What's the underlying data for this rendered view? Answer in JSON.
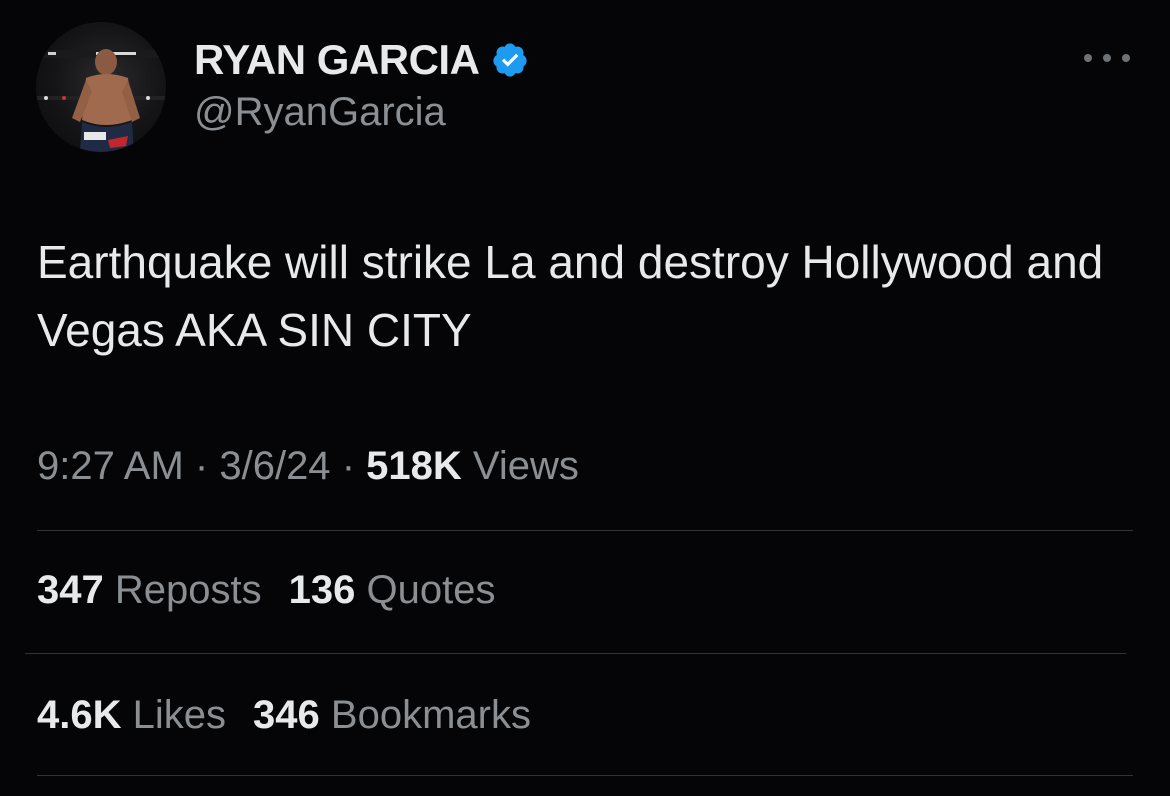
{
  "author": {
    "display_name": "RYAN GARCIA",
    "handle": "@RyanGarcia",
    "verified": true,
    "verified_color": "#1d9bf0"
  },
  "tweet": {
    "text": "Earthquake will strike La and destroy Hollywood and Vegas AKA SIN CITY",
    "time": "9:27 AM",
    "date": "3/6/24",
    "separator": "·",
    "views_count": "518K",
    "views_label": "Views"
  },
  "engagement": {
    "reposts_count": "347",
    "reposts_label": "Reposts",
    "quotes_count": "136",
    "quotes_label": "Quotes",
    "likes_count": "4.6K",
    "likes_label": "Likes",
    "bookmarks_count": "346",
    "bookmarks_label": "Bookmarks"
  },
  "icons": {
    "avatar": "profile-photo",
    "verified": "verified-badge-icon",
    "more": "more-options-icon"
  },
  "colors": {
    "background": "#050406",
    "primary_text": "#e7e9ea",
    "secondary_text": "#8b8f94",
    "divider": "#2f3336"
  }
}
